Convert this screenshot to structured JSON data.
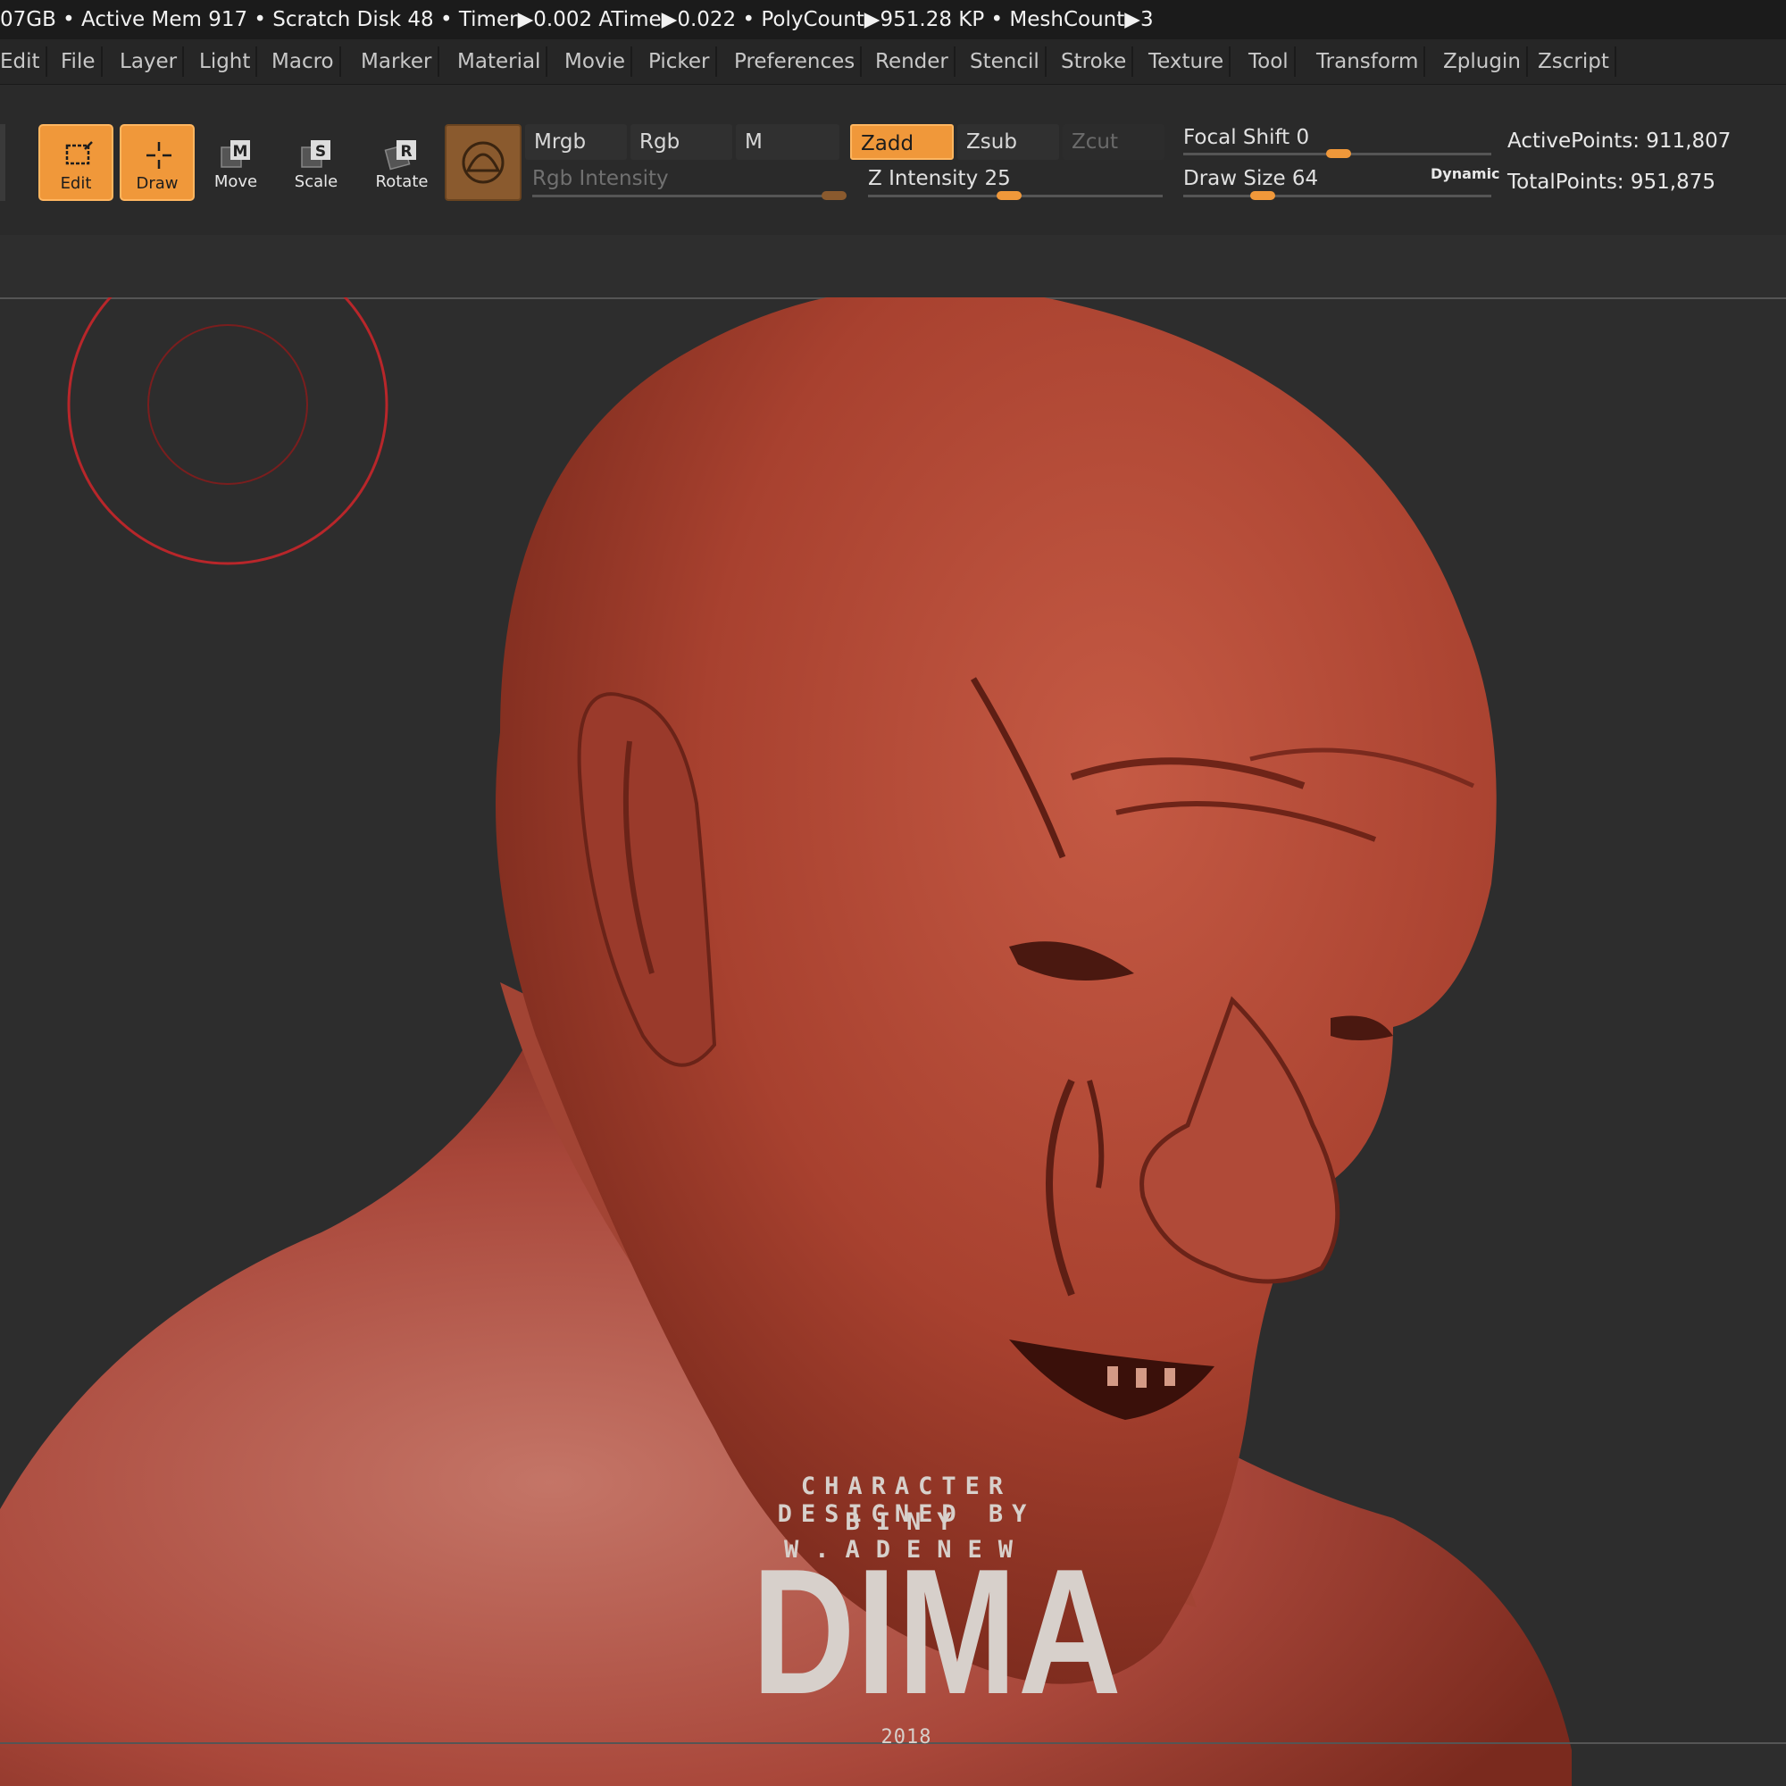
{
  "status_bar": {
    "text": "07GB • Active Mem 917 • Scratch Disk 48 •  Timer▶0.002 ATime▶0.022 • PolyCount▶951.28 KP  • MeshCount▶3"
  },
  "menu": {
    "items": [
      "Edit",
      "File",
      "Layer",
      "Light",
      "Macro",
      "Marker",
      "Material",
      "Movie",
      "Picker",
      "Preferences",
      "Render",
      "Stencil",
      "Stroke",
      "Texture",
      "Tool",
      "Transform",
      "Zplugin",
      "Zscript"
    ]
  },
  "toolbar": {
    "tools": [
      {
        "label": "Edit",
        "icon": "edit-icon",
        "active": true
      },
      {
        "label": "Draw",
        "icon": "draw-icon",
        "active": true
      },
      {
        "label": "Move",
        "icon": "move-icon",
        "active": false
      },
      {
        "label": "Scale",
        "icon": "scale-icon",
        "active": false
      },
      {
        "label": "Rotate",
        "icon": "rotate-icon",
        "active": false
      }
    ],
    "material_icon": "material-sphere-icon",
    "mrgb": "Mrgb",
    "rgb": "Rgb",
    "m": "M",
    "rgb_intensity_label": "Rgb Intensity",
    "zadd": "Zadd",
    "zsub": "Zsub",
    "zcut": "Zcut",
    "z_intensity_label": "Z Intensity",
    "z_intensity_value": "25",
    "focal_shift_label": "Focal Shift",
    "focal_shift_value": "0",
    "draw_size_label": "Draw Size",
    "draw_size_value": "64",
    "dynamic_label": "Dynamic",
    "active_points": "ActivePoints: 911,807",
    "total_points": "TotalPoints: 951,875",
    "accent_color": "#f0983a"
  },
  "canvas": {
    "model": "sculpted bald character bust (red clay material)",
    "brush_cursor_color": "#b8262a",
    "clay_color": "#a8412f"
  },
  "credit": {
    "line1": "CHARACTER DESIGNED BY",
    "line2": "BINY  W.ADENEW",
    "title": "DIMA",
    "year": "2018"
  }
}
